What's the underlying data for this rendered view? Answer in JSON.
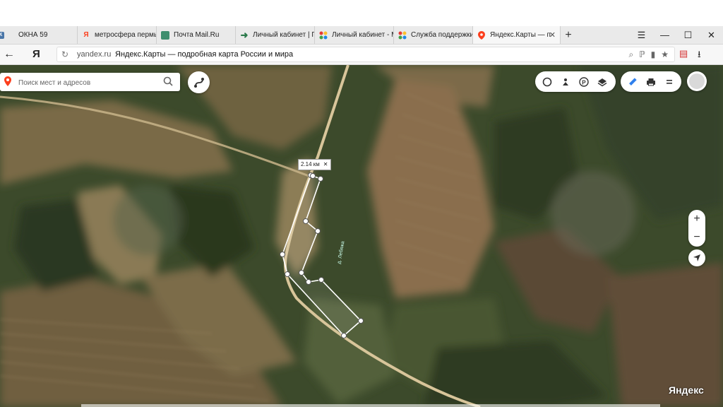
{
  "tabs": [
    {
      "label": "ОКНА 59",
      "icon": "vk-icon"
    },
    {
      "label": "метросфера пермь",
      "icon": "yandex-icon"
    },
    {
      "label": "Почта Mail.Ru",
      "icon": "mail-icon"
    },
    {
      "label": "Личный кабинет | П",
      "icon": "arrow-icon"
    },
    {
      "label": "Личный кабинет - М",
      "icon": "colorful-icon"
    },
    {
      "label": "Служба поддержки",
      "icon": "colorful-icon"
    },
    {
      "label": "Яндекс.Карты — п",
      "icon": "map-pin-icon",
      "active": true
    }
  ],
  "address": {
    "domain": "yandex.ru",
    "title": "Яндекс.Карты — подробная карта России и мира",
    "logo": "Я"
  },
  "search": {
    "placeholder": "Поиск мест и адресов"
  },
  "measure": {
    "distance": "2.14 км"
  },
  "map": {
    "road_label": "д. Лебяжа",
    "zoom_in": "+",
    "zoom_out": "−",
    "brand": "Яндекс"
  },
  "colors": {
    "accent": "#fc3f1d",
    "route": "#ffffff"
  }
}
